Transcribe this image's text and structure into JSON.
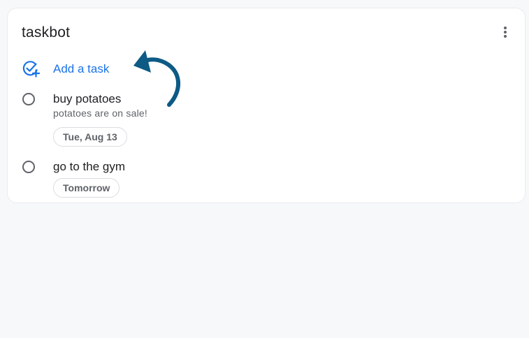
{
  "app": {
    "title": "taskbot"
  },
  "header": {
    "menu_icon": "more-vert-icon"
  },
  "add_task": {
    "label": "Add a task",
    "icon": "add-task-icon"
  },
  "tasks": [
    {
      "title": "buy potatoes",
      "note": "potatoes are on sale!",
      "due": "Tue, Aug 13"
    },
    {
      "title": "go to the gym",
      "due": "Tomorrow"
    }
  ],
  "colors": {
    "accent": "#1a73e8",
    "annotation_arrow": "#0d5a85",
    "text_primary": "#202124",
    "text_secondary": "#5f6368"
  }
}
